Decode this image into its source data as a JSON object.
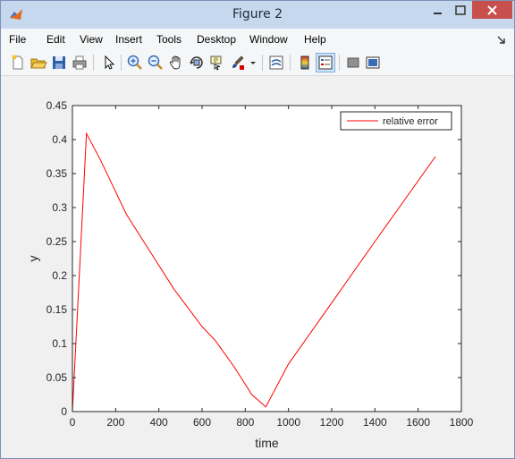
{
  "window": {
    "title": "Figure 2",
    "app_icon": "matlab-icon"
  },
  "menu": {
    "items": [
      "File",
      "Edit",
      "View",
      "Insert",
      "Tools",
      "Desktop",
      "Window",
      "Help"
    ]
  },
  "toolbar": {
    "tools": [
      "new-figure-icon",
      "open-file-icon",
      "save-icon",
      "print-icon",
      "pointer-icon",
      "zoom-in-icon",
      "zoom-out-icon",
      "pan-icon",
      "rotate-3d-icon",
      "data-cursor-icon",
      "brush-icon",
      "link-plot-icon",
      "colorbar-icon",
      "legend-icon",
      "hide-plot-tools-icon",
      "show-plot-tools-icon"
    ]
  },
  "chart_data": {
    "type": "line",
    "xlabel": "time",
    "ylabel": "y",
    "xlim": [
      0,
      1800
    ],
    "ylim": [
      0,
      0.45
    ],
    "x_ticks": [
      "0",
      "200",
      "400",
      "600",
      "800",
      "1000",
      "1200",
      "1400",
      "1600",
      "1800"
    ],
    "y_ticks": [
      "0",
      "0.05",
      "0.1",
      "0.15",
      "0.2",
      "0.25",
      "0.3",
      "0.35",
      "0.4",
      "0.45"
    ],
    "grid": false,
    "legend_position": "top-right",
    "series": [
      {
        "name": "relative error",
        "color": "#ff0000",
        "x": [
          0,
          65,
          130,
          250,
          360,
          470,
          600,
          660,
          750,
          830,
          895,
          1000,
          1200,
          1400,
          1680
        ],
        "y": [
          0.0,
          0.409,
          0.37,
          0.29,
          0.235,
          0.18,
          0.125,
          0.105,
          0.065,
          0.025,
          0.007,
          0.07,
          0.16,
          0.25,
          0.375
        ]
      },
      {
        "name": "",
        "color": "#ff0000",
        "x": [
          0,
          1690
        ],
        "y": [
          0,
          0
        ]
      }
    ]
  }
}
